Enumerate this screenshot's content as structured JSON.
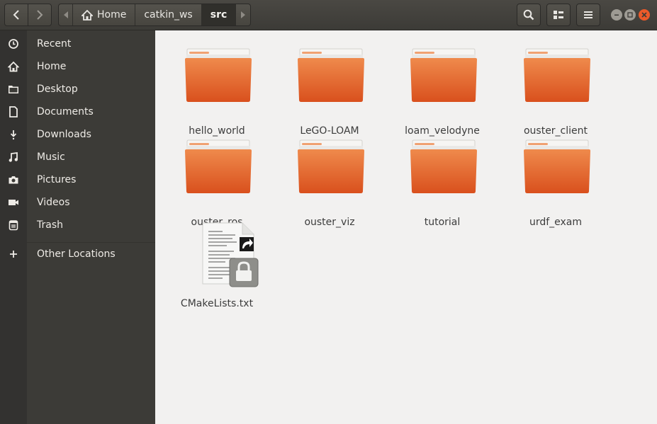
{
  "breadcrumbs": [
    "Home",
    "catkin_ws",
    "src"
  ],
  "sidebar": {
    "items": [
      {
        "label": "Recent",
        "icon": "clock-icon"
      },
      {
        "label": "Home",
        "icon": "home-icon"
      },
      {
        "label": "Desktop",
        "icon": "folder-icon"
      },
      {
        "label": "Documents",
        "icon": "document-icon"
      },
      {
        "label": "Downloads",
        "icon": "download-icon"
      },
      {
        "label": "Music",
        "icon": "music-icon"
      },
      {
        "label": "Pictures",
        "icon": "camera-icon"
      },
      {
        "label": "Videos",
        "icon": "video-icon"
      },
      {
        "label": "Trash",
        "icon": "trash-icon"
      }
    ],
    "other_locations": "Other Locations"
  },
  "files": [
    {
      "name": "hello_world",
      "type": "folder"
    },
    {
      "name": "LeGO-LOAM",
      "type": "folder"
    },
    {
      "name": "loam_velodyne",
      "type": "folder"
    },
    {
      "name": "ouster_client",
      "type": "folder"
    },
    {
      "name": "ouster_ros",
      "type": "folder"
    },
    {
      "name": "ouster_viz",
      "type": "folder"
    },
    {
      "name": "tutorial",
      "type": "folder"
    },
    {
      "name": "urdf_exam",
      "type": "folder"
    },
    {
      "name": "CMakeLists.txt",
      "type": "locked-symlink-text-file"
    }
  ],
  "colors": {
    "accent": "#e95420",
    "folder": "#e0632a",
    "headerbar": "#3c3b37",
    "close": "#ec5a2a"
  }
}
